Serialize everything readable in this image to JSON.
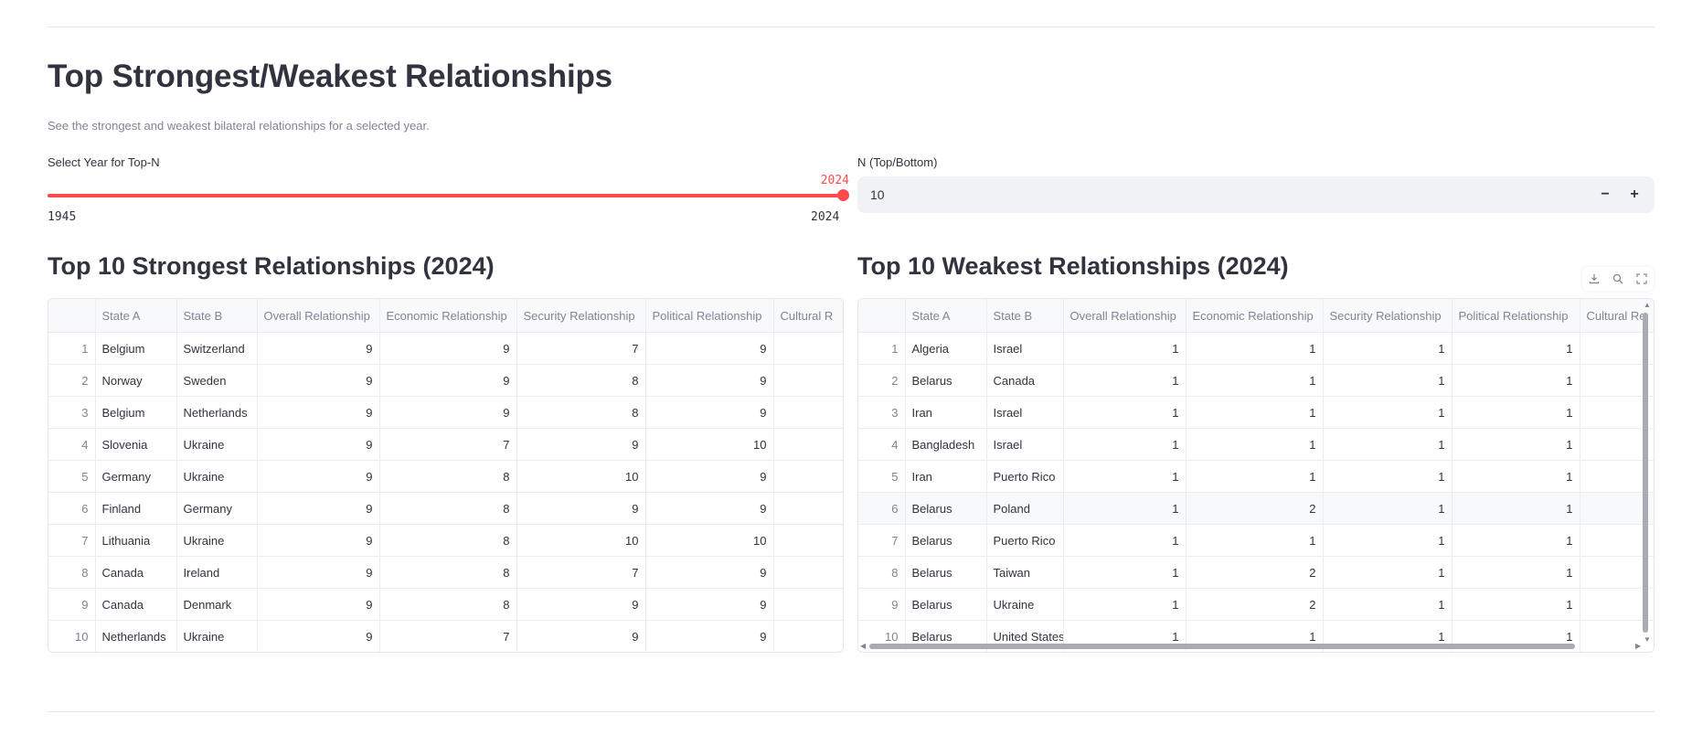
{
  "page": {
    "title": "Top Strongest/Weakest Relationships",
    "caption": "See the strongest and weakest bilateral relationships for a selected year."
  },
  "year_slider": {
    "label": "Select Year for Top-N",
    "value": "2024",
    "min": "1945",
    "max": "2024",
    "position_fraction": 1.0,
    "accent_color": "#ff4b4b"
  },
  "n_input": {
    "label": "N (Top/Bottom)",
    "value": "10",
    "minus": "−",
    "plus": "+"
  },
  "strongest": {
    "title": "Top 10 Strongest Relationships (2024)",
    "columns": [
      "",
      "State A",
      "State B",
      "Overall Relationship",
      "Economic Relationship",
      "Security Relationship",
      "Political Relationship",
      "Cultural R"
    ],
    "rows": [
      [
        "1",
        "Belgium",
        "Switzerland",
        "9",
        "9",
        "7",
        "9",
        ""
      ],
      [
        "2",
        "Norway",
        "Sweden",
        "9",
        "9",
        "8",
        "9",
        ""
      ],
      [
        "3",
        "Belgium",
        "Netherlands",
        "9",
        "9",
        "8",
        "9",
        ""
      ],
      [
        "4",
        "Slovenia",
        "Ukraine",
        "9",
        "7",
        "9",
        "10",
        ""
      ],
      [
        "5",
        "Germany",
        "Ukraine",
        "9",
        "8",
        "10",
        "9",
        ""
      ],
      [
        "6",
        "Finland",
        "Germany",
        "9",
        "8",
        "9",
        "9",
        ""
      ],
      [
        "7",
        "Lithuania",
        "Ukraine",
        "9",
        "8",
        "10",
        "10",
        ""
      ],
      [
        "8",
        "Canada",
        "Ireland",
        "9",
        "8",
        "7",
        "9",
        ""
      ],
      [
        "9",
        "Canada",
        "Denmark",
        "9",
        "8",
        "9",
        "9",
        ""
      ],
      [
        "10",
        "Netherlands",
        "Ukraine",
        "9",
        "7",
        "9",
        "9",
        ""
      ]
    ]
  },
  "weakest": {
    "title": "Top 10 Weakest Relationships (2024)",
    "columns": [
      "",
      "State A",
      "State B",
      "Overall Relationship",
      "Economic Relationship",
      "Security Relationship",
      "Political Relationship",
      "Cultural Re"
    ],
    "rows": [
      [
        "1",
        "Algeria",
        "Israel",
        "1",
        "1",
        "1",
        "1",
        ""
      ],
      [
        "2",
        "Belarus",
        "Canada",
        "1",
        "1",
        "1",
        "1",
        ""
      ],
      [
        "3",
        "Iran",
        "Israel",
        "1",
        "1",
        "1",
        "1",
        ""
      ],
      [
        "4",
        "Bangladesh",
        "Israel",
        "1",
        "1",
        "1",
        "1",
        ""
      ],
      [
        "5",
        "Iran",
        "Puerto Rico",
        "1",
        "1",
        "1",
        "1",
        ""
      ],
      [
        "6",
        "Belarus",
        "Poland",
        "1",
        "2",
        "1",
        "1",
        ""
      ],
      [
        "7",
        "Belarus",
        "Puerto Rico",
        "1",
        "1",
        "1",
        "1",
        ""
      ],
      [
        "8",
        "Belarus",
        "Taiwan",
        "1",
        "2",
        "1",
        "1",
        ""
      ],
      [
        "9",
        "Belarus",
        "Ukraine",
        "1",
        "2",
        "1",
        "1",
        ""
      ],
      [
        "10",
        "Belarus",
        "United States",
        "1",
        "1",
        "1",
        "1",
        ""
      ]
    ],
    "toolbar": [
      "download-icon",
      "search-icon",
      "fullscreen-icon"
    ]
  }
}
